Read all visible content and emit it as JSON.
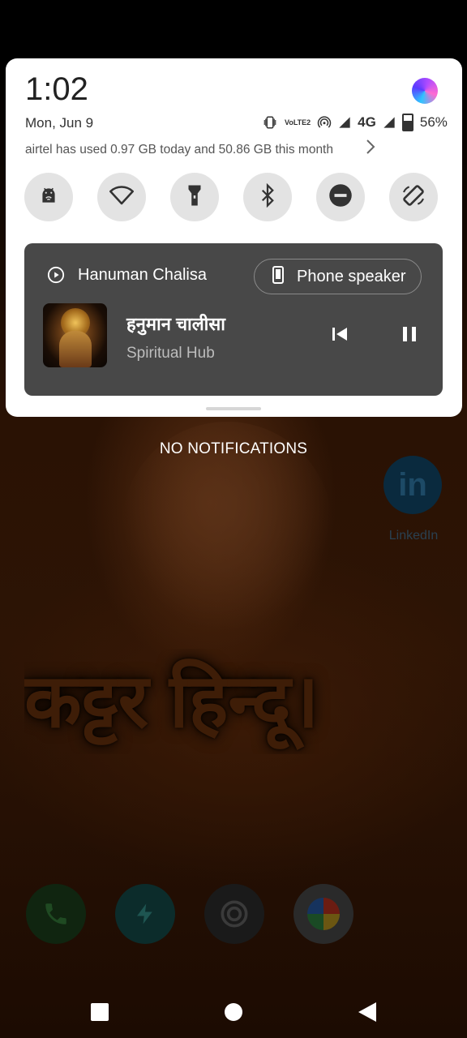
{
  "status": {
    "time": "1:02",
    "date": "Mon, Jun 9",
    "network_volte": "VoLTE2",
    "network_type": "4G",
    "battery": "56%"
  },
  "data_usage": "airtel has used 0.97 GB today and 50.86 GB this month",
  "quick_tiles": [
    {
      "name": "android-wifi-debug-tile",
      "icon": "android-icon"
    },
    {
      "name": "wifi-tile",
      "icon": "wifi-icon"
    },
    {
      "name": "flashlight-tile",
      "icon": "flashlight-icon"
    },
    {
      "name": "bluetooth-tile",
      "icon": "bluetooth-icon"
    },
    {
      "name": "do-not-disturb-tile",
      "icon": "dnd-icon"
    },
    {
      "name": "auto-rotate-tile",
      "icon": "rotate-icon"
    }
  ],
  "media": {
    "app_name": "Hanuman Chalisa",
    "output_device": "Phone speaker",
    "title": "हनुमान चालीसा",
    "artist": "Spiritual Hub"
  },
  "notifications_empty": "NO NOTIFICATIONS",
  "wallpaper": {
    "text": "कट्टर हिन्दू।",
    "linkedin_label": "LinkedIn",
    "linkedin_glyph": "in"
  },
  "colors": {
    "shade_bg": "#ffffff",
    "media_bg": "#484848",
    "tile_bg": "#e3e3e3"
  }
}
